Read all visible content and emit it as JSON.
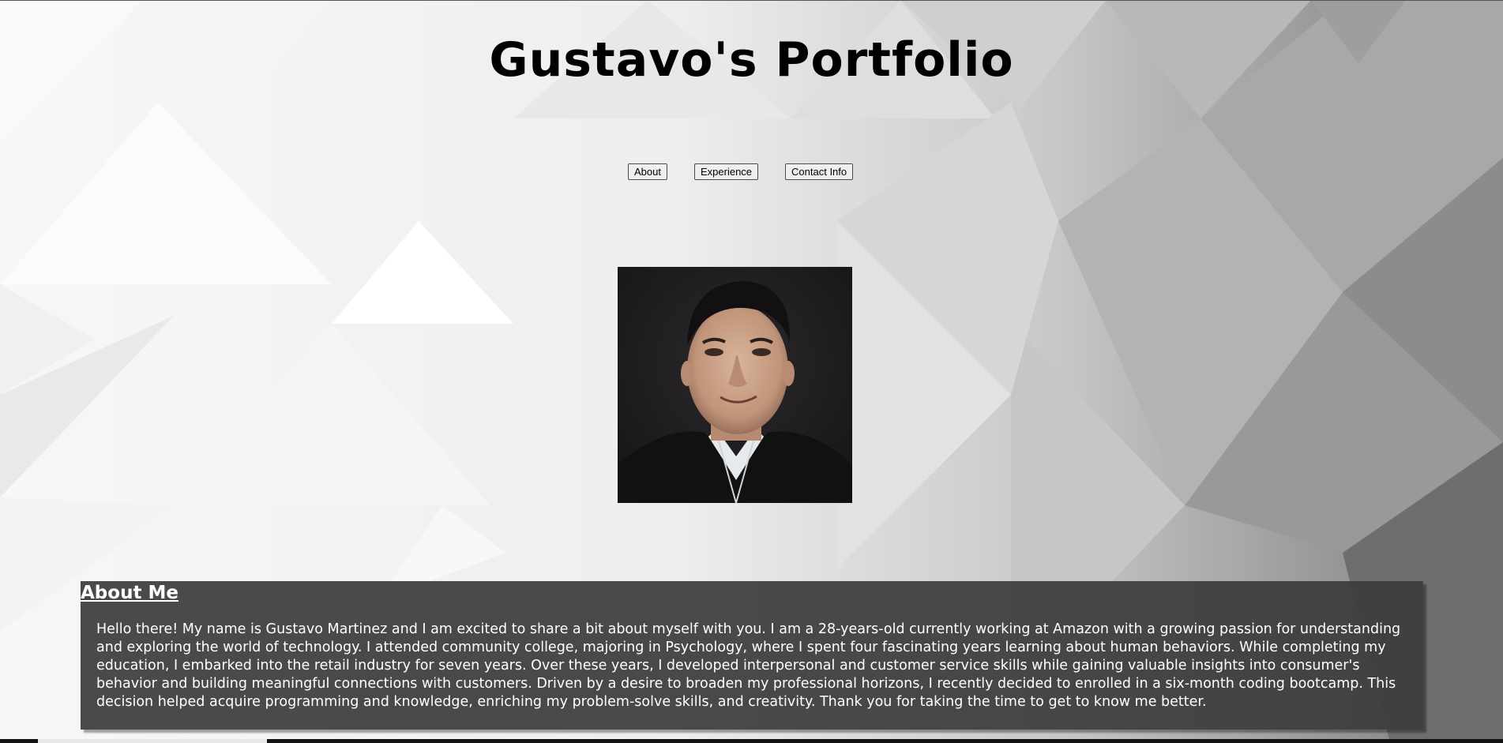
{
  "page": {
    "title": "Gustavo's Portfolio"
  },
  "nav": {
    "items": [
      {
        "label": "About"
      },
      {
        "label": "Experience"
      },
      {
        "label": "Contact Info"
      }
    ]
  },
  "profile": {
    "photo_icon": "portrait-photo"
  },
  "about": {
    "heading": "About Me",
    "body": "Hello there! My name is Gustavo Martinez and I am excited to share a bit about myself with you. I am a 28-years-old currently working at Amazon with a growing passion for understanding and exploring the world of technology. I attended community college, majoring in Psychology, where I spent four fascinating years learning about human behaviors. While completing my education, I embarked into the retail industry for seven years. Over these years, I developed interpersonal and customer service skills while gaining valuable insights into consumer's behavior and building meaningful connections with customers. Driven by a desire to broaden my professional horizons, I recently decided to enrolled in a six-month coding bootcamp. This decision helped acquire programming and knowledge, enriching my problem-solve skills, and creativity. Thank you for taking the time to get to know me better."
  },
  "colors": {
    "about_background": "#3c3c3c",
    "title_text": "#000000",
    "about_text": "#ffffff"
  }
}
